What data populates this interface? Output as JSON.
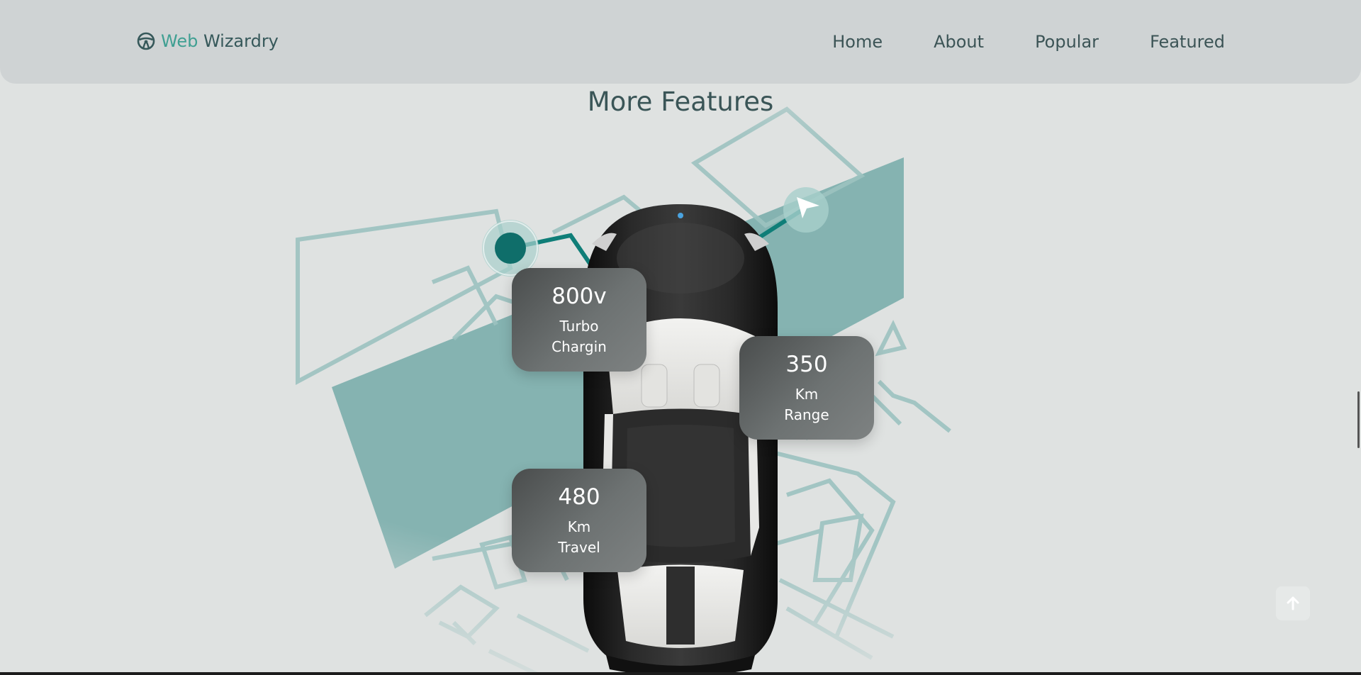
{
  "brand": {
    "accent": "Web",
    "rest": " Wizardry",
    "icon": "steering-wheel-icon"
  },
  "nav": {
    "items": [
      "Home",
      "About",
      "Popular",
      "Featured"
    ]
  },
  "section": {
    "title": "More Features"
  },
  "cards": [
    {
      "value": "800v",
      "line1": "Turbo",
      "line2": "Chargin"
    },
    {
      "value": "350",
      "line1": "Km",
      "line2": "Range"
    },
    {
      "value": "480",
      "line1": "Km",
      "line2": "Travel"
    }
  ],
  "scroll_top": {
    "icon": "arrow-up-icon"
  },
  "colors": {
    "teal": "#85b3b1",
    "accent": "#3f9f92",
    "pin": "#0f6e6a",
    "text": "#3a5557"
  }
}
